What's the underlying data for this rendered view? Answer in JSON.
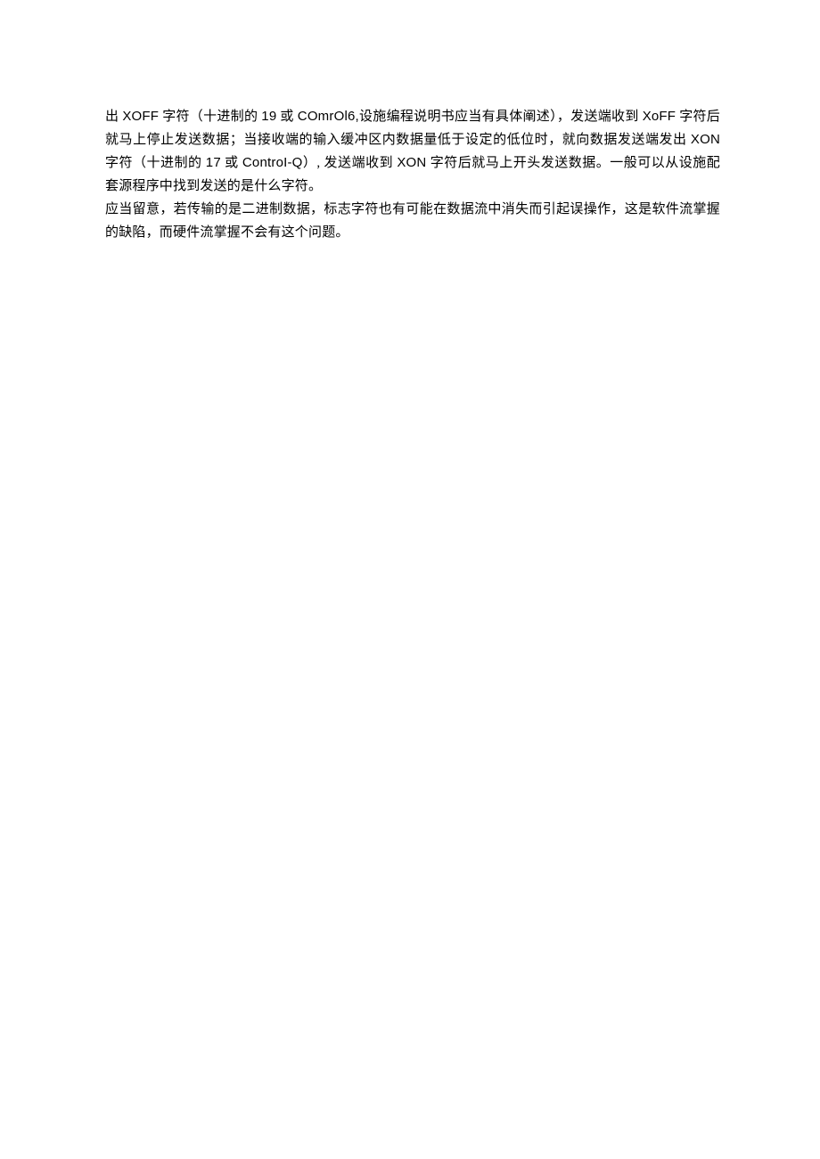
{
  "document": {
    "paragraphs": [
      {
        "runs": [
          {
            "text": "出 ",
            "latin": false
          },
          {
            "text": "XOFF",
            "latin": true
          },
          {
            "text": " 字符（十进制的 ",
            "latin": false
          },
          {
            "text": "19",
            "latin": true
          },
          {
            "text": " 或 ",
            "latin": false
          },
          {
            "text": "COmrOl6,",
            "latin": true
          },
          {
            "text": "设施编程说明书应当有具体阐述），发送端收到 ",
            "latin": false
          },
          {
            "text": "XoFF",
            "latin": true
          },
          {
            "text": " 字符后就马上停止发送数据；当接收端的输入缓冲区内数据量低于设定的低位时，就向数据发送端发出 ",
            "latin": false
          },
          {
            "text": "XON",
            "latin": true
          },
          {
            "text": " 字符（十进制的 ",
            "latin": false
          },
          {
            "text": "17",
            "latin": true
          },
          {
            "text": " 或 ",
            "latin": false
          },
          {
            "text": "ControI-Q",
            "latin": true
          },
          {
            "text": "）, 发送端收到 ",
            "latin": false
          },
          {
            "text": "XON",
            "latin": true
          },
          {
            "text": " 字符后就马上开头发送数据。一般可以从设施配套源程序中找到发送的是什么字符。",
            "latin": false
          }
        ]
      },
      {
        "runs": [
          {
            "text": "应当留意，若传输的是二进制数据，标志字符也有可能在数据流中消失而引起误操作，这是软件流掌握的缺陷，而硬件流掌握不会有这个问题。",
            "latin": false
          }
        ]
      }
    ]
  }
}
